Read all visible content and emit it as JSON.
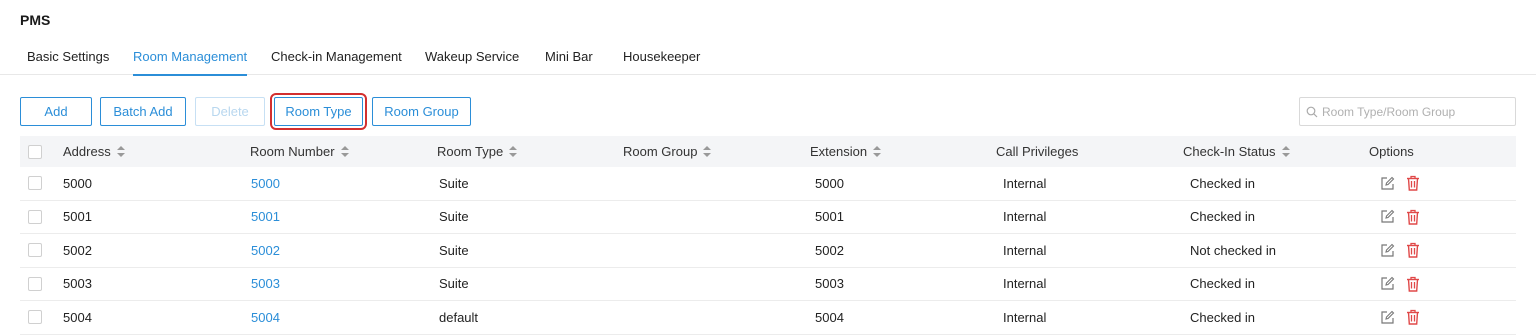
{
  "app": {
    "title": "PMS"
  },
  "tabs": [
    {
      "label": "Basic Settings",
      "active": false
    },
    {
      "label": "Room Management",
      "active": true
    },
    {
      "label": "Check-in Management",
      "active": false
    },
    {
      "label": "Wakeup Service",
      "active": false
    },
    {
      "label": "Mini Bar",
      "active": false
    },
    {
      "label": "Housekeeper",
      "active": false
    }
  ],
  "toolbar": {
    "add_label": "Add",
    "batch_add_label": "Batch Add",
    "delete_label": "Delete",
    "room_type_label": "Room Type",
    "room_group_label": "Room Group"
  },
  "search": {
    "placeholder": "Room Type/Room Group",
    "value": ""
  },
  "table": {
    "headers": {
      "address": "Address",
      "room_number": "Room Number",
      "room_type": "Room Type",
      "room_group": "Room Group",
      "extension": "Extension",
      "call_privileges": "Call Privileges",
      "check_in_status": "Check-In Status",
      "options": "Options"
    },
    "rows": [
      {
        "address": "5000",
        "room_number": "5000",
        "room_type": "Suite",
        "room_group": "",
        "extension": "5000",
        "call_privileges": "Internal",
        "check_in_status": "Checked in"
      },
      {
        "address": "5001",
        "room_number": "5001",
        "room_type": "Suite",
        "room_group": "",
        "extension": "5001",
        "call_privileges": "Internal",
        "check_in_status": "Checked in"
      },
      {
        "address": "5002",
        "room_number": "5002",
        "room_type": "Suite",
        "room_group": "",
        "extension": "5002",
        "call_privileges": "Internal",
        "check_in_status": "Not checked in"
      },
      {
        "address": "5003",
        "room_number": "5003",
        "room_type": "Suite",
        "room_group": "",
        "extension": "5003",
        "call_privileges": "Internal",
        "check_in_status": "Checked in"
      },
      {
        "address": "5004",
        "room_number": "5004",
        "room_type": "default",
        "room_group": "",
        "extension": "5004",
        "call_privileges": "Internal",
        "check_in_status": "Checked in"
      }
    ]
  },
  "colors": {
    "accent": "#2b8ed8",
    "highlight_border": "#d32f2f",
    "delete_icon": "#e04848",
    "header_bg": "#f4f5f7"
  },
  "icons": {
    "search": "search-icon",
    "sort": "sort-icon",
    "edit": "edit-icon",
    "delete": "trash-icon"
  }
}
